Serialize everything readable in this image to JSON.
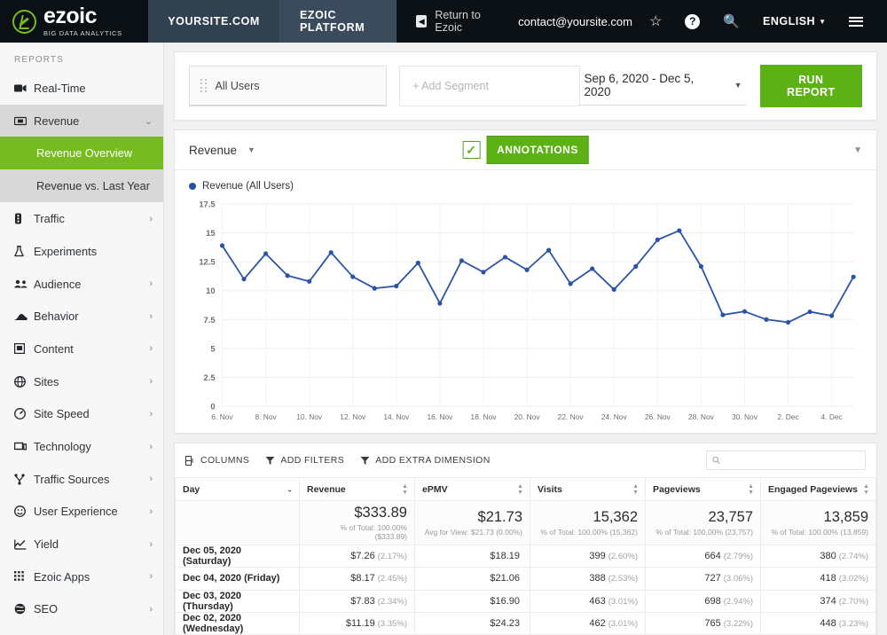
{
  "header": {
    "logo_word": "ezoic",
    "logo_sub": "BIG DATA ANALYTICS",
    "tabs": [
      {
        "label": "YOURSITE.COM",
        "active": false
      },
      {
        "label": "EZOIC PLATFORM",
        "active": true
      }
    ],
    "return_label": "Return to Ezoic",
    "return_icon": "back-arrow-icon",
    "email": "contact@yoursite.com",
    "icons": [
      "star-icon",
      "help-icon",
      "search-icon"
    ],
    "language": "ENGLISH",
    "menu_icon": "hamburger-menu-icon"
  },
  "sidebar": {
    "section_label": "REPORTS",
    "items": [
      {
        "label": "Real-Time",
        "icon": "video-camera-icon",
        "arrow": "",
        "state": ""
      },
      {
        "label": "Revenue",
        "icon": "revenue-card-icon",
        "arrow": "⌄",
        "state": "open"
      },
      {
        "label": "Traffic",
        "icon": "traffic-light-icon",
        "arrow": "›",
        "state": ""
      },
      {
        "label": "Experiments",
        "icon": "flask-icon",
        "arrow": "",
        "state": ""
      },
      {
        "label": "Audience",
        "icon": "people-icon",
        "arrow": "›",
        "state": ""
      },
      {
        "label": "Behavior",
        "icon": "behavior-icon",
        "arrow": "›",
        "state": ""
      },
      {
        "label": "Content",
        "icon": "content-layout-icon",
        "arrow": "›",
        "state": ""
      },
      {
        "label": "Sites",
        "icon": "globe-icon",
        "arrow": "›",
        "state": ""
      },
      {
        "label": "Site Speed",
        "icon": "speedometer-icon",
        "arrow": "›",
        "state": ""
      },
      {
        "label": "Technology",
        "icon": "devices-icon",
        "arrow": "›",
        "state": ""
      },
      {
        "label": "Traffic Sources",
        "icon": "branch-icon",
        "arrow": "›",
        "state": ""
      },
      {
        "label": "User Experience",
        "icon": "smiley-icon",
        "arrow": "›",
        "state": ""
      },
      {
        "label": "Yield",
        "icon": "line-chart-icon",
        "arrow": "›",
        "state": ""
      },
      {
        "label": "Ezoic Apps",
        "icon": "grid-apps-icon",
        "arrow": "›",
        "state": ""
      },
      {
        "label": "SEO",
        "icon": "seo-globe-icon",
        "arrow": "›",
        "state": ""
      }
    ],
    "sub_items": [
      {
        "label": "Revenue Overview",
        "active": true
      },
      {
        "label": "Revenue vs. Last Year",
        "active": false
      }
    ]
  },
  "segment_bar": {
    "segment_label": "All Users",
    "add_segment_placeholder": "+ Add Segment",
    "date_range": "Sep 6, 2020 - Dec 5, 2020",
    "run_report_label": "RUN REPORT"
  },
  "chart_panel": {
    "metric_label": "Revenue",
    "annotations_label": "ANNOTATIONS",
    "annotations_checked": true,
    "legend_label": "Revenue (All Users)",
    "collapse_icon": "chevron-down-icon"
  },
  "chart_data": {
    "type": "line",
    "title": "Revenue (All Users)",
    "xlabel": "",
    "ylabel": "",
    "ylim": [
      0,
      17.5
    ],
    "yticks": [
      "0",
      "2.5",
      "5",
      "7.5",
      "10",
      "12.5",
      "15",
      "17.5"
    ],
    "xticks": [
      "6. Nov",
      "8. Nov",
      "10. Nov",
      "12. Nov",
      "14. Nov",
      "16. Nov",
      "18. Nov",
      "20. Nov",
      "22. Nov",
      "24. Nov",
      "26. Nov",
      "28. Nov",
      "30. Nov",
      "2. Dec",
      "4. Dec"
    ],
    "grid": true,
    "legend_position": "top-left",
    "series": [
      {
        "name": "Revenue (All Users)",
        "color": "#2a53a8",
        "x": [
          "6. Nov",
          "7. Nov",
          "8. Nov",
          "9. Nov",
          "10. Nov",
          "11. Nov",
          "12. Nov",
          "13. Nov",
          "14. Nov",
          "15. Nov",
          "16. Nov",
          "17. Nov",
          "18. Nov",
          "19. Nov",
          "20. Nov",
          "21. Nov",
          "22. Nov",
          "23. Nov",
          "24. Nov",
          "25. Nov",
          "26. Nov",
          "27. Nov",
          "28. Nov",
          "29. Nov",
          "30. Nov",
          "1. Dec",
          "2. Dec",
          "3. Dec",
          "4. Dec",
          "5. Dec"
        ],
        "values": [
          13.9,
          11.0,
          13.2,
          11.3,
          10.8,
          13.3,
          11.2,
          10.2,
          10.4,
          12.4,
          8.9,
          12.6,
          11.6,
          12.9,
          11.8,
          13.5,
          10.6,
          11.9,
          10.1,
          12.1,
          14.4,
          15.2,
          12.1,
          7.9,
          8.2,
          7.5,
          7.26,
          8.17,
          7.83,
          11.19
        ]
      }
    ]
  },
  "table": {
    "toolbar": {
      "columns_label": "COLUMNS",
      "add_filters_label": "ADD FILTERS",
      "add_dimension_label": "ADD EXTRA DIMENSION",
      "search_placeholder": "",
      "search_value": "",
      "search_icon": "magnifier-icon"
    },
    "columns": [
      "Day",
      "Revenue",
      "ePMV",
      "Visits",
      "Pageviews",
      "Engaged Pageviews"
    ],
    "totals": [
      {
        "value": "",
        "sub": ""
      },
      {
        "value": "$333.89",
        "sub": "% of Total: 100.00% ($333.89)"
      },
      {
        "value": "$21.73",
        "sub": "Avg for View: $21.73 (0.00%)"
      },
      {
        "value": "15,362",
        "sub": "% of Total: 100.00% (15,362)"
      },
      {
        "value": "23,757",
        "sub": "% of Total: 100.00% (23,757)"
      },
      {
        "value": "13,859",
        "sub": "% of Total: 100.00% (13,859)"
      }
    ],
    "rows": [
      {
        "day": "Dec 05, 2020 (Saturday)",
        "revenue": "$7.26",
        "revenue_pct": "(2.17%)",
        "epmv": "$18.19",
        "epmv_pct": "",
        "visits": "399",
        "visits_pct": "(2.60%)",
        "pageviews": "664",
        "pageviews_pct": "(2.79%)",
        "engaged": "380",
        "engaged_pct": "(2.74%)"
      },
      {
        "day": "Dec 04, 2020 (Friday)",
        "revenue": "$8.17",
        "revenue_pct": "(2.45%)",
        "epmv": "$21.06",
        "epmv_pct": "",
        "visits": "388",
        "visits_pct": "(2.53%)",
        "pageviews": "727",
        "pageviews_pct": "(3.06%)",
        "engaged": "418",
        "engaged_pct": "(3.02%)"
      },
      {
        "day": "Dec 03, 2020 (Thursday)",
        "revenue": "$7.83",
        "revenue_pct": "(2.34%)",
        "epmv": "$16.90",
        "epmv_pct": "",
        "visits": "463",
        "visits_pct": "(3.01%)",
        "pageviews": "698",
        "pageviews_pct": "(2.94%)",
        "engaged": "374",
        "engaged_pct": "(2.70%)"
      },
      {
        "day": "Dec 02, 2020 (Wednesday)",
        "revenue": "$11.19",
        "revenue_pct": "(3.35%)",
        "epmv": "$24.23",
        "epmv_pct": "",
        "visits": "462",
        "visits_pct": "(3.01%)",
        "pageviews": "765",
        "pageviews_pct": "(3.22%)",
        "engaged": "448",
        "engaged_pct": "(3.23%)"
      }
    ]
  },
  "colors": {
    "brand_green": "#76bc21",
    "button_green": "#5cb215",
    "line_blue": "#2a53a8",
    "topbar_dark": "#0c1116",
    "tab_slate": "#31414f"
  }
}
